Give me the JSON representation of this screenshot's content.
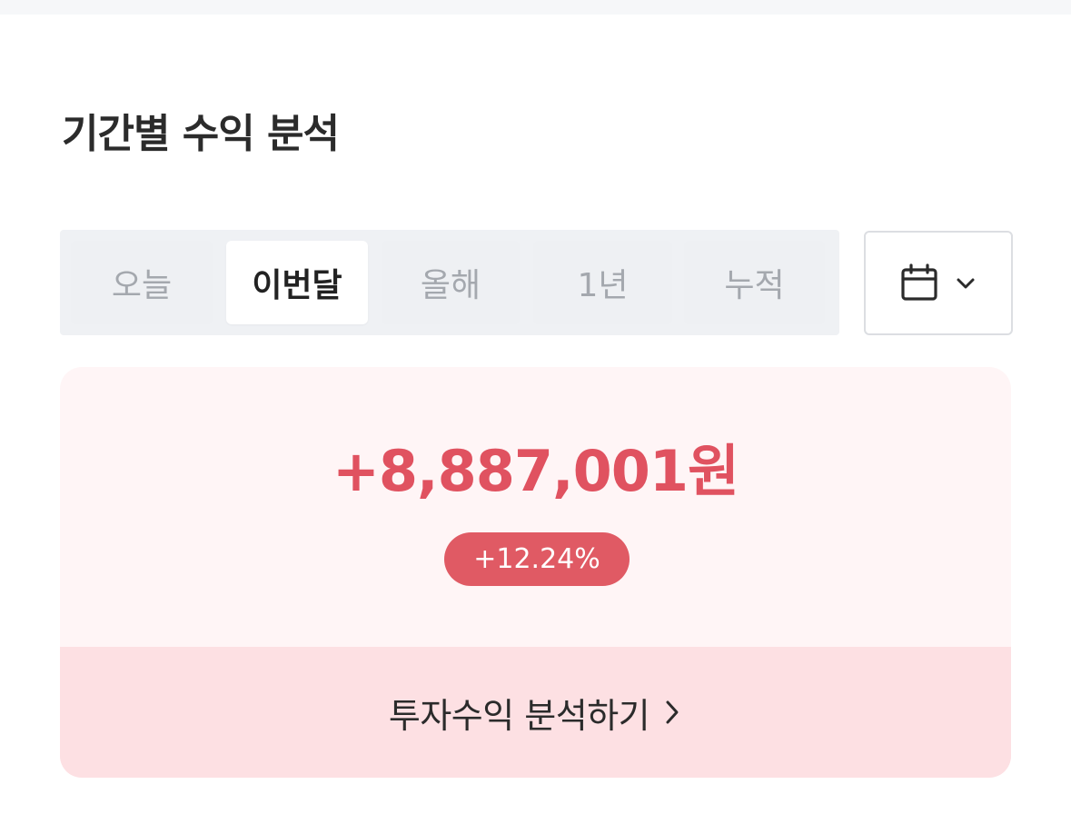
{
  "section": {
    "title": "기간별 수익 분석"
  },
  "period_tabs": {
    "items": [
      {
        "label": "오늘",
        "active": false
      },
      {
        "label": "이번달",
        "active": true
      },
      {
        "label": "올해",
        "active": false
      },
      {
        "label": "1년",
        "active": false
      },
      {
        "label": "누적",
        "active": false
      }
    ],
    "selected": "이번달"
  },
  "date_picker": {
    "icon": "calendar-icon",
    "dropdown_icon": "chevron-down-icon"
  },
  "profit_card": {
    "amount": "+8,887,001원",
    "rate": "+12.24%",
    "link_label": "투자수익 분석하기",
    "link_icon": "chevron-right-icon"
  },
  "colors": {
    "profit_red": "#e05260",
    "badge_red": "#e05a64",
    "card_bg": "#fff5f6",
    "link_bg": "#fde0e3",
    "tab_bg": "#eff1f4"
  }
}
